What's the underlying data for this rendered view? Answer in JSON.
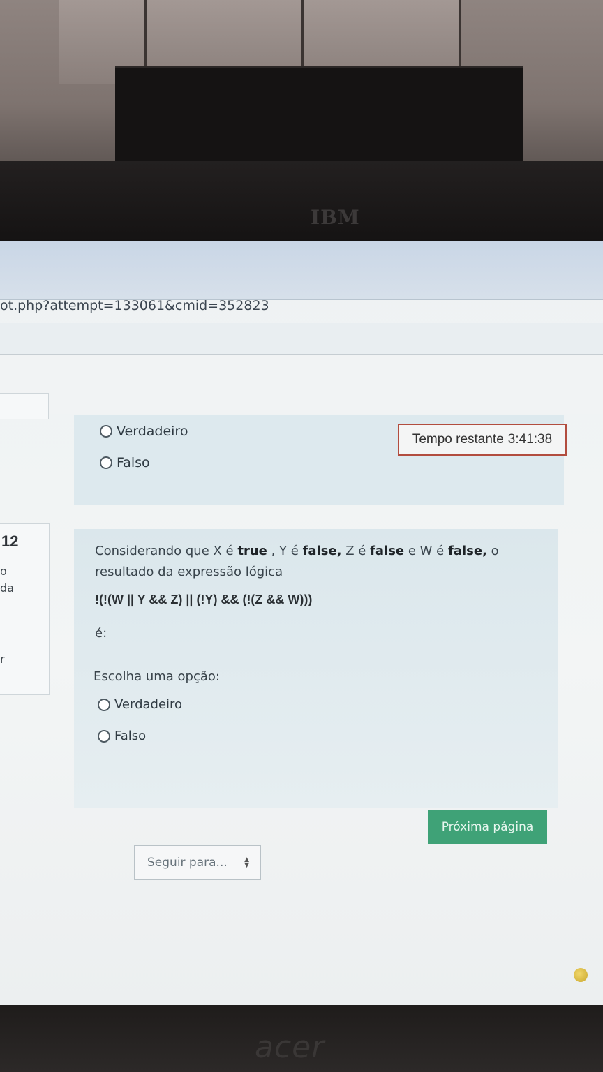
{
  "browser": {
    "url_fragment": "ot.php?attempt=133061&cmid=352823"
  },
  "timer": {
    "label": "Tempo restante",
    "value": "3:41:38"
  },
  "previous_question": {
    "options": [
      "Verdadeiro",
      "Falso"
    ]
  },
  "question": {
    "number": "12",
    "side_fragments": [
      "o",
      "da",
      "r"
    ],
    "text_parts": [
      "Considerando que X é ",
      "true",
      " , Y é ",
      "false,",
      " Z é ",
      "false",
      " e W é ",
      "false,",
      " o resultado da expressão lógica"
    ],
    "expression": "!(!(W || Y &&  Z) || (!Y) && (!(Z && W)))",
    "suffix": "é:",
    "prompt": "Escolha uma opção:",
    "options": [
      "Verdadeiro",
      "Falso"
    ]
  },
  "navigation": {
    "next_label": "Próxima página",
    "jump_label": "Seguir para..."
  },
  "brands": {
    "monitor_top": "IBM",
    "monitor_bottom": "acer"
  }
}
